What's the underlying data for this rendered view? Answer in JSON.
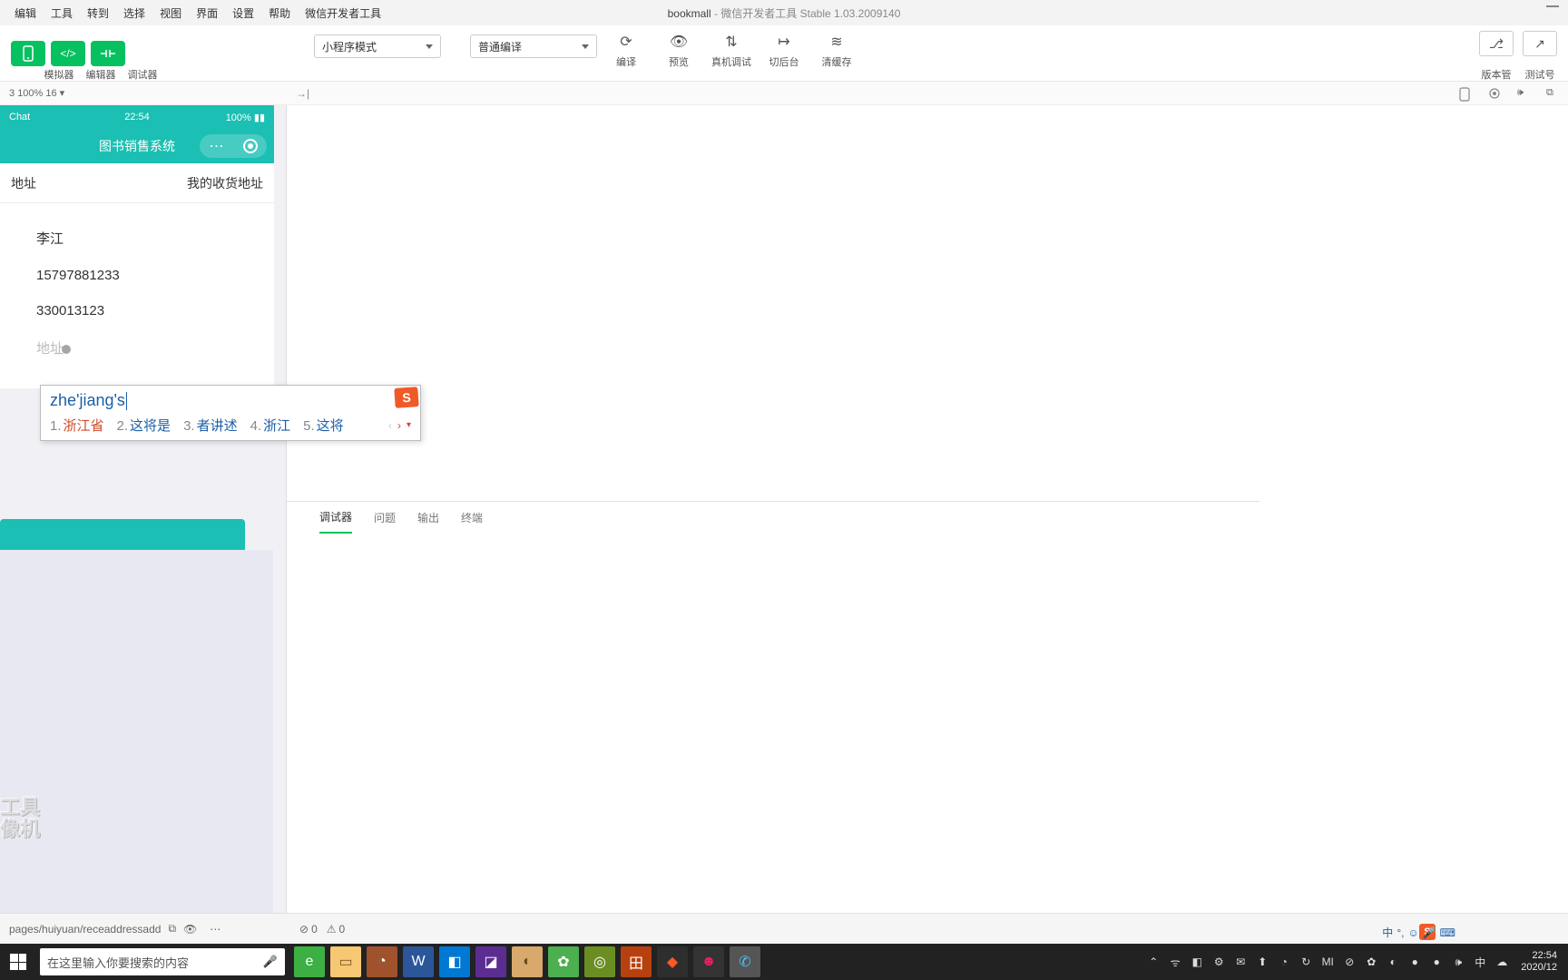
{
  "window": {
    "project": "bookmall",
    "subtitle": "微信开发者工具 Stable 1.03.2009140"
  },
  "menu": [
    "编辑",
    "工具",
    "转到",
    "选择",
    "视图",
    "界面",
    "设置",
    "帮助",
    "微信开发者工具"
  ],
  "viewLabels": [
    "模拟器",
    "编辑器",
    "调试器"
  ],
  "modeSelect": "小程序模式",
  "compileSelect": "普通编译",
  "actions": [
    {
      "label": "编译"
    },
    {
      "label": "预览"
    },
    {
      "label": "真机调试"
    },
    {
      "label": "切后台"
    },
    {
      "label": "清缓存"
    }
  ],
  "rightActions": [
    "版本管理",
    "测试号"
  ],
  "subbar": {
    "zoom": "100% 16",
    "prefix": "3"
  },
  "phone": {
    "carrier": "Chat",
    "time": "22:54",
    "battery": "100%",
    "title": "图书销售系统",
    "tabLeft": "地址",
    "tabRight": "我的收货地址",
    "form": {
      "name": "李江",
      "phone": "15797881233",
      "zip": "330013123",
      "addrPlaceholder": "地址"
    }
  },
  "watermark": {
    "l1": "工具",
    "l2": "像机"
  },
  "ime": {
    "input": "zhe'jiang's",
    "candidates": [
      {
        "n": "1.",
        "t": "浙江省"
      },
      {
        "n": "2.",
        "t": "这将是"
      },
      {
        "n": "3.",
        "t": "者讲述"
      },
      {
        "n": "4.",
        "t": "浙江"
      },
      {
        "n": "5.",
        "t": "这将"
      }
    ]
  },
  "bottomTabs": [
    "调试器",
    "问题",
    "输出",
    "终端"
  ],
  "status": {
    "path": "pages/huiyuan/receaddressadd",
    "err": "0",
    "warn": "0"
  },
  "search": {
    "placeholder": "在这里输入你要搜索的内容"
  },
  "tray": {
    "time": "22:54",
    "date": "2020/12"
  },
  "lang": "中",
  "taskbarApps": [
    {
      "bg": "#3cb043",
      "fg": "#fff",
      "g": "e"
    },
    {
      "bg": "#f7c873",
      "fg": "#7a5a20",
      "g": "▭"
    },
    {
      "bg": "#a0522d",
      "fg": "#fff",
      "g": "◔"
    },
    {
      "bg": "#2b579a",
      "fg": "#fff",
      "g": "W"
    },
    {
      "bg": "#0078d4",
      "fg": "#fff",
      "g": "◧"
    },
    {
      "bg": "#5c2d91",
      "fg": "#fff",
      "g": "◪"
    },
    {
      "bg": "#d8a96b",
      "fg": "#6b4a1a",
      "g": "◐"
    },
    {
      "bg": "#4caf50",
      "fg": "#fff",
      "g": "✿"
    },
    {
      "bg": "#6b8e23",
      "fg": "#fff",
      "g": "◎"
    },
    {
      "bg": "#b7410e",
      "fg": "#fff",
      "g": "田"
    },
    {
      "bg": "#2e2e2e",
      "fg": "#ff5722",
      "g": "◆"
    },
    {
      "bg": "#333",
      "fg": "#e91e63",
      "g": "☻"
    },
    {
      "bg": "#555",
      "fg": "#4fc3f7",
      "g": "✆"
    }
  ],
  "trayIcons": [
    "⌃",
    "ᯤ",
    "◧",
    "⚙",
    "✉",
    "⬆",
    "◔",
    "↻",
    "MI",
    "⊘",
    "✿",
    "◐",
    "●",
    "●",
    "🕪",
    "中",
    "☁"
  ]
}
